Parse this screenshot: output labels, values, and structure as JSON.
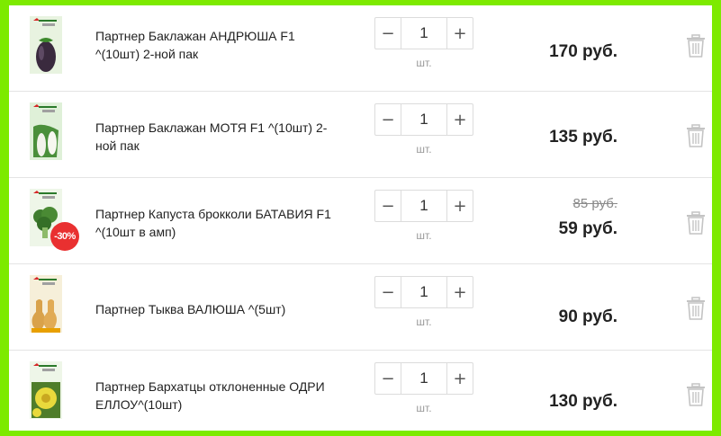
{
  "cart": {
    "items": [
      {
        "name": "Партнер Баклажан АНДРЮША F1 ^(10шт) 2-ной пак",
        "quantity": "1",
        "unit": "шт.",
        "price": "170 руб.",
        "old_price": null,
        "discount": null,
        "image": "eggplant-dark-seed-packet"
      },
      {
        "name": "Партнер Баклажан МОТЯ F1 ^(10шт) 2-ной пак",
        "quantity": "1",
        "unit": "шт.",
        "price": "135 руб.",
        "old_price": null,
        "discount": null,
        "image": "eggplant-white-seed-packet"
      },
      {
        "name": "Партнер Капуста брокколи БАТАВИЯ F1 ^(10шт в амп)",
        "quantity": "1",
        "unit": "шт.",
        "price": "59 руб.",
        "old_price": "85 руб.",
        "discount": "-30%",
        "image": "broccoli-seed-packet"
      },
      {
        "name": "Партнер Тыква ВАЛЮША ^(5шт)",
        "quantity": "1",
        "unit": "шт.",
        "price": "90 руб.",
        "old_price": null,
        "discount": null,
        "image": "pumpkin-seed-packet"
      },
      {
        "name": "Партнер Бархатцы отклоненные ОДРИ ЕЛЛОУ^(10шт)",
        "quantity": "1",
        "unit": "шт.",
        "price": "130 руб.",
        "old_price": null,
        "discount": null,
        "image": "marigold-seed-packet"
      }
    ],
    "controls": {
      "minus": "−",
      "plus": "+"
    },
    "icons": {
      "delete": "trash-icon"
    },
    "colors": {
      "frame": "#7dea00",
      "discount_badge": "#e93030",
      "trash": "#c4c4c4"
    }
  }
}
